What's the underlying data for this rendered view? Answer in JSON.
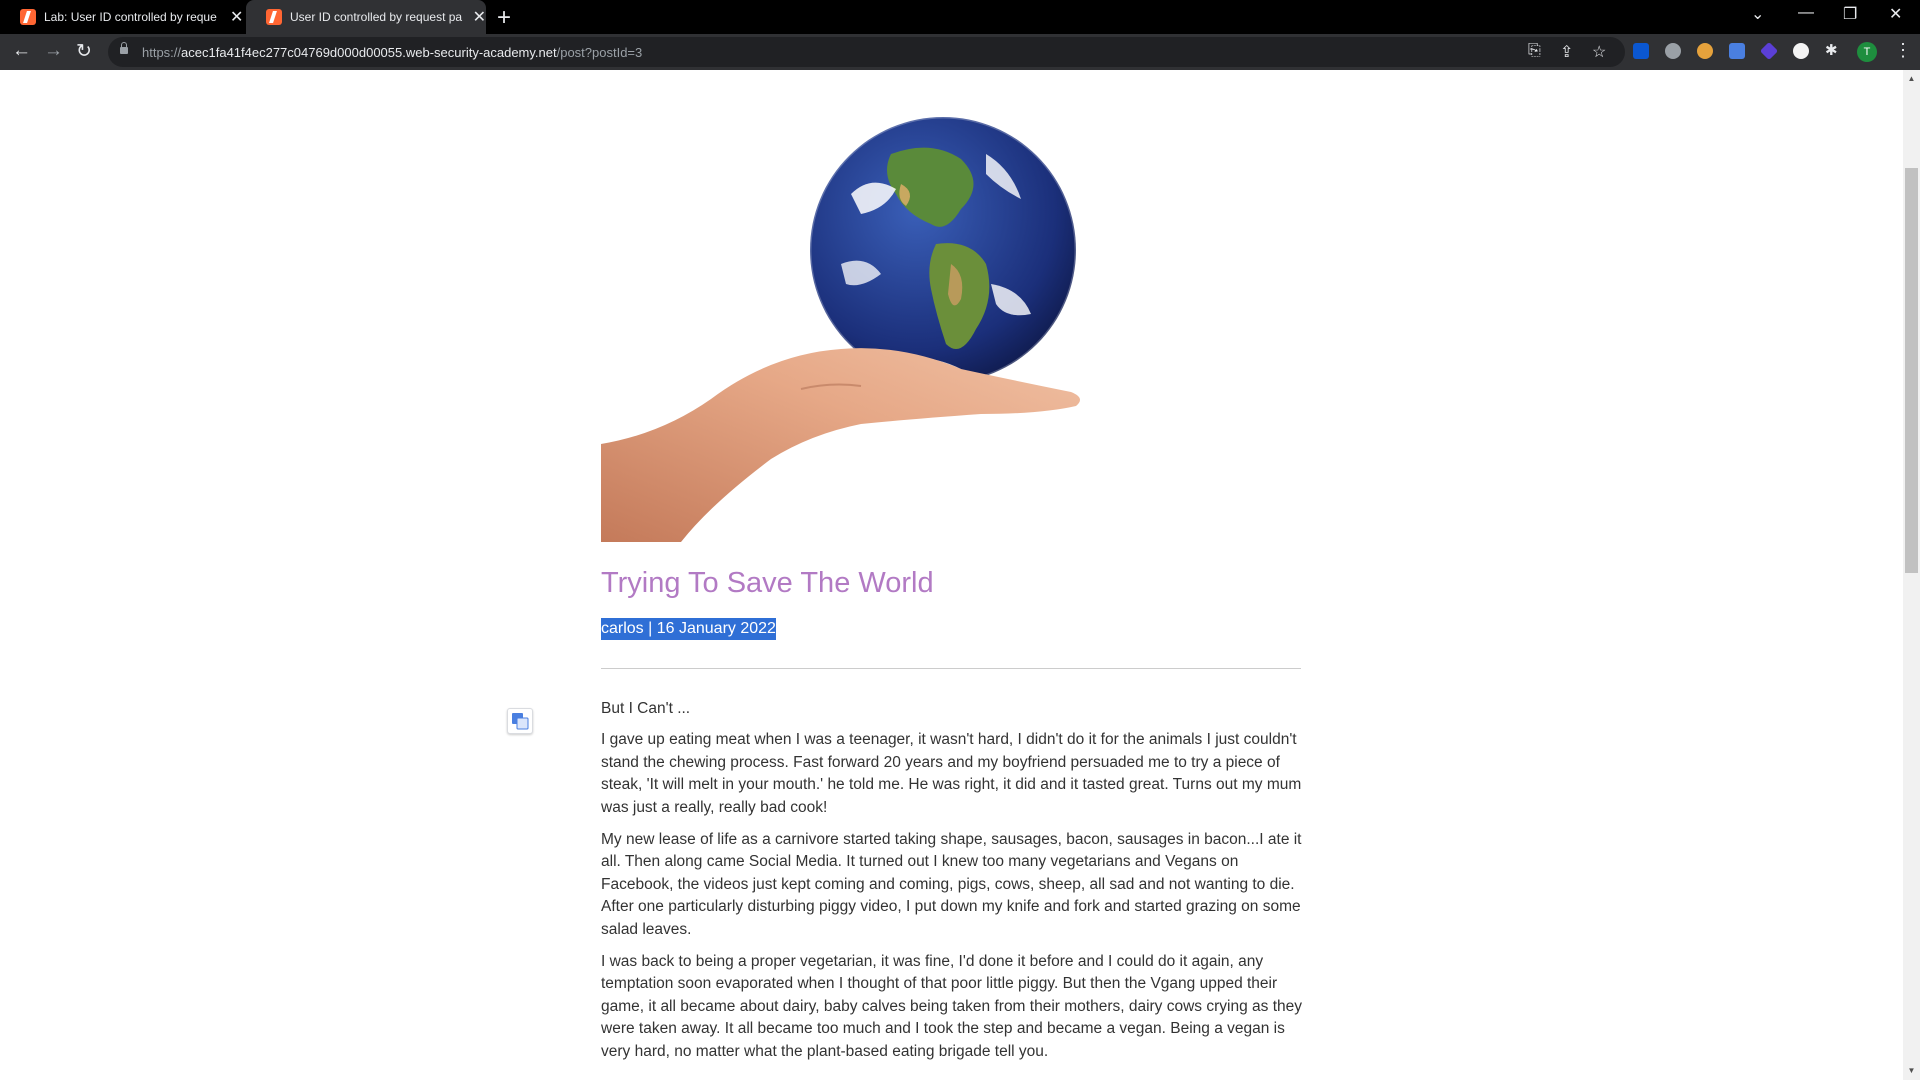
{
  "browser": {
    "tabs": [
      {
        "title": "Lab: User ID controlled by reque",
        "active": false
      },
      {
        "title": "User ID controlled by request pa",
        "active": true
      }
    ],
    "url": {
      "scheme": "https://",
      "host": "acec1fa41f4ec277c04769d000d00055.web-security-academy.net",
      "path": "/post?postId=3"
    },
    "profile_initial": "T",
    "accent": "#ff6633"
  },
  "post": {
    "title": "Trying To Save The World",
    "meta": "carlos | 16 January 2022",
    "title_color": "#b27ac4",
    "image_alt": "Earth globe held on an open hand",
    "paragraphs": [
      "But I Can't ...",
      "I gave up eating meat when I was a teenager, it wasn't hard, I didn't do it for the animals I just couldn't stand the chewing process. Fast forward 20 years and my boyfriend persuaded me to try a piece of steak, 'It will melt in your mouth.' he told me. He was right, it did and it tasted great. Turns out my mum was just a really, really bad cook!",
      "My new lease of life as a carnivore started taking shape, sausages, bacon, sausages in bacon...I ate it all. Then along came Social Media. It turned out I knew too many vegetarians and Vegans on Facebook, the videos just kept coming and coming, pigs, cows, sheep, all sad and not wanting to die. After one particularly disturbing piggy video, I put down my knife and fork and started grazing on some salad leaves.",
      "I was back to being a proper vegetarian, it was fine, I'd done it before and I could do it again, any temptation soon evaporated when I thought of that poor little piggy. But then the Vgang upped their game, it all became about dairy, baby calves being taken from their mothers, dairy cows crying as they were taken away. It all became too much and I took the step and became a vegan. Being a vegan is very hard, no matter what the plant-based eating brigade tell you."
    ]
  }
}
